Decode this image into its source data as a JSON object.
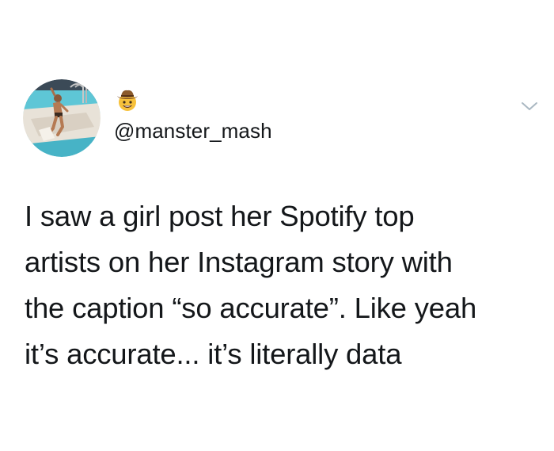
{
  "tweet": {
    "avatar_icon": "profile-photo",
    "emoji_icon": "cowboy-hat-face-emoji",
    "handle": "@manster_mash",
    "menu_icon": "chevron-down-icon",
    "text_lines": [
      "I saw a girl post her Spotify top",
      "artists on her Instagram story with",
      "the caption “so accurate”. Like yeah",
      "it’s accurate... it’s literally data"
    ]
  },
  "colors": {
    "background": "#ffffff",
    "text": "#14171a",
    "chevron": "#aab8c2"
  }
}
